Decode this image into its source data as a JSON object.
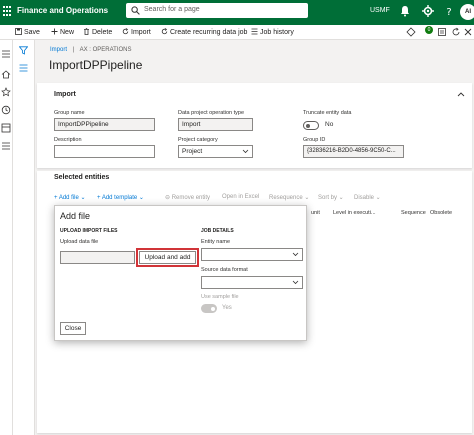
{
  "topbar": {
    "app_title": "Finance and Operations",
    "search_placeholder": "Search for a page",
    "company": "USMF",
    "avatar_initials": "AI",
    "colors": {
      "bar": "#006e37",
      "accent": "#0078d4",
      "highlight": "#d13438"
    }
  },
  "actionbar": {
    "save": "Save",
    "new": "New",
    "delete": "Delete",
    "import": "Import",
    "create_recurring": "Create recurring data job",
    "job_history": "Job history",
    "notification_count": "0"
  },
  "breadcrumb": {
    "link": "Import",
    "sep": "|",
    "rest": "AX : OPERATIONS"
  },
  "page_title": "ImportDPPipeline",
  "import_section": {
    "title": "Import",
    "group_name_label": "Group name",
    "group_name_value": "ImportDPPipeline",
    "data_project_op_label": "Data project operation type",
    "data_project_op_value": "Import",
    "truncate_label": "Truncate entity data",
    "truncate_value": "No",
    "description_label": "Description",
    "description_value": "",
    "project_category_label": "Project category",
    "project_category_value": "Project",
    "group_id_label": "Group ID",
    "group_id_value": "{32836216-B2D0-4856-9C50-C..."
  },
  "selected_entities": {
    "title": "Selected entities",
    "add_file": "Add file",
    "add_template": "Add template",
    "remove_entity": "Remove entity",
    "open_in_excel": "Open in Excel",
    "resequence": "Resequence",
    "sort_by": "Sort by",
    "disable": "Disable",
    "columns": [
      "unit",
      "Level in executi...",
      "Sequence",
      "Obsolete"
    ]
  },
  "dialog": {
    "title": "Add file",
    "upload_section": "UPLOAD IMPORT FILES",
    "upload_label": "Upload data file",
    "upload_value": "",
    "upload_button": "Upload and add",
    "job_details": "JOB DETAILS",
    "entity_name_label": "Entity name",
    "entity_name_value": "",
    "source_format_label": "Source data format",
    "source_format_value": "",
    "use_sample_label": "Use sample file",
    "use_sample_value": "Yes",
    "close_button": "Close"
  }
}
